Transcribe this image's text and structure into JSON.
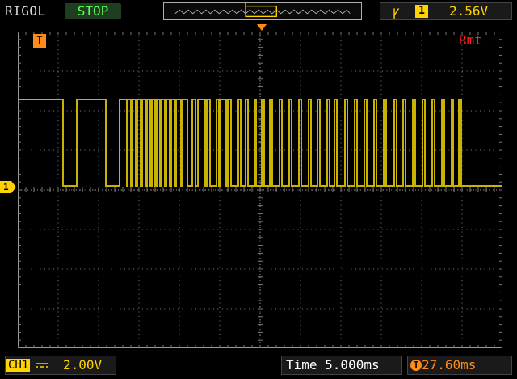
{
  "header": {
    "brand": "RIGOL",
    "run_status": "STOP",
    "trigger": {
      "edge_icon": "rising-edge-icon",
      "source": "1",
      "level": "2.56V"
    }
  },
  "screen": {
    "remote_label": "Rmt",
    "trigger_marker": "T",
    "ch1_marker": "1",
    "trace_color": "#c8b400",
    "signal_states": [
      1,
      0,
      1,
      0,
      1,
      0,
      1,
      0,
      1,
      0,
      1,
      0,
      1,
      0,
      1,
      0,
      1,
      0,
      1,
      0,
      1,
      0,
      1,
      0,
      1,
      0,
      1,
      0,
      1,
      0,
      1,
      0,
      1,
      0,
      1,
      0,
      1,
      0,
      1,
      0,
      1,
      0,
      1,
      0,
      1,
      0,
      1,
      0,
      1,
      0,
      1,
      0,
      1,
      0,
      1,
      0,
      1,
      0,
      1,
      0,
      1,
      0,
      1,
      0,
      1,
      0,
      1,
      0,
      1,
      0,
      1,
      0,
      1,
      0,
      1,
      0,
      1,
      0,
      1,
      0,
      1,
      0,
      1,
      0,
      1,
      0,
      1,
      0,
      1,
      0,
      1,
      0,
      1,
      0,
      1,
      0,
      1
    ],
    "transition_times_ms": [
      -24.4,
      -22.7,
      -19.1,
      -17.4,
      -16.5,
      -16.4,
      -16.0,
      -15.8,
      -15.4,
      -15.2,
      -14.8,
      -14.6,
      -14.2,
      -14.0,
      -13.6,
      -13.4,
      -13.0,
      -12.8,
      -12.4,
      -12.2,
      -11.8,
      -11.6,
      -11.2,
      -11.0,
      -10.6,
      -10.4,
      -9.8,
      -9.6,
      -9.0,
      -8.4,
      -8.0,
      -7.7,
      -6.8,
      -6.6,
      -6.2,
      -5.4,
      -5.1,
      -4.9,
      -4.2,
      -4.0,
      -3.6,
      -2.7,
      -2.4,
      -1.8,
      -1.5,
      -0.7,
      -0.5,
      0.2,
      0.5,
      1.2,
      1.5,
      2.4,
      2.7,
      3.6,
      3.9,
      4.8,
      5.1,
      6.0,
      6.3,
      7.1,
      7.4,
      8.3,
      8.6,
      9.2,
      9.5,
      10.5,
      10.8,
      11.7,
      12.0,
      12.9,
      13.2,
      14.1,
      14.4,
      15.3,
      15.6,
      16.6,
      16.9,
      17.7,
      18.0,
      18.9,
      19.2,
      20.1,
      20.4,
      21.3,
      21.6,
      22.5,
      22.8,
      23.7,
      23.9,
      24.6,
      24.9
    ]
  },
  "footer": {
    "channel_name": "CH1",
    "channel_scale": "2.00V",
    "timebase": "Time 5.000ms",
    "trigger_offset": "27.60ms",
    "offset_icon": "T"
  }
}
